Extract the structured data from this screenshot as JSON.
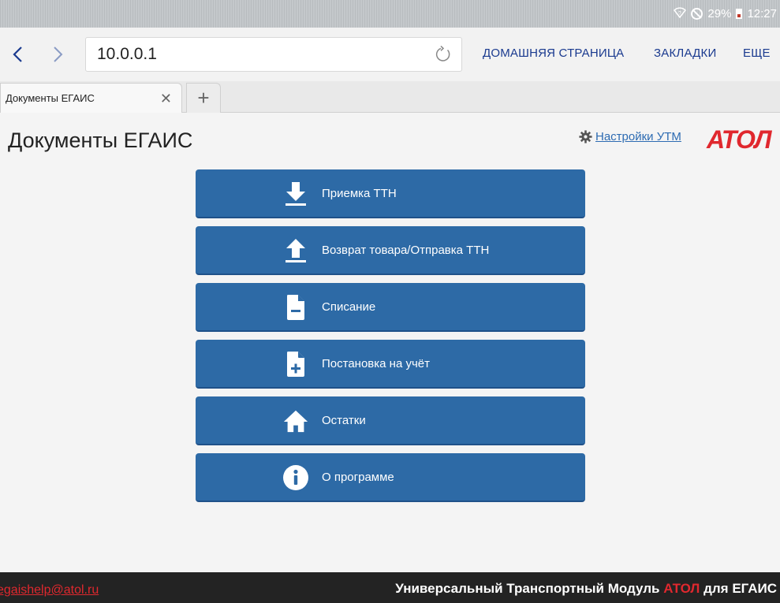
{
  "status_bar": {
    "battery": "29%",
    "time": "12:27"
  },
  "toolbar": {
    "url": "10.0.0.1",
    "home_label": "ДОМАШНЯЯ СТРАНИЦА",
    "bookmarks_label": "ЗАКЛАДКИ",
    "more_label": "ЕЩЕ"
  },
  "tabs": [
    {
      "title": "Документы ЕГАИС"
    }
  ],
  "page": {
    "title": "Документы ЕГАИС",
    "settings_link": "Настройки УТМ",
    "logo_text": "АТОЛ",
    "buttons": [
      {
        "label": "Приемка ТТН",
        "icon": "download-icon"
      },
      {
        "label": "Возврат товара/Отправка ТТН",
        "icon": "upload-icon"
      },
      {
        "label": "Списание",
        "icon": "file-minus-icon"
      },
      {
        "label": "Постановка на учёт",
        "icon": "file-plus-icon"
      },
      {
        "label": "Остатки",
        "icon": "home-icon"
      },
      {
        "label": "О программе",
        "icon": "info-icon"
      }
    ]
  },
  "footer": {
    "email": "egaishelp@atol.ru",
    "text_prefix": "Универсальный Транспортный Модуль ",
    "text_brand": "АТОЛ",
    "text_suffix": " для ЕГАИС"
  },
  "colors": {
    "button_blue": "#2d6aa6",
    "brand_red": "#e0282e",
    "link_blue": "#2d6bb2",
    "footer_bg": "#232323"
  }
}
